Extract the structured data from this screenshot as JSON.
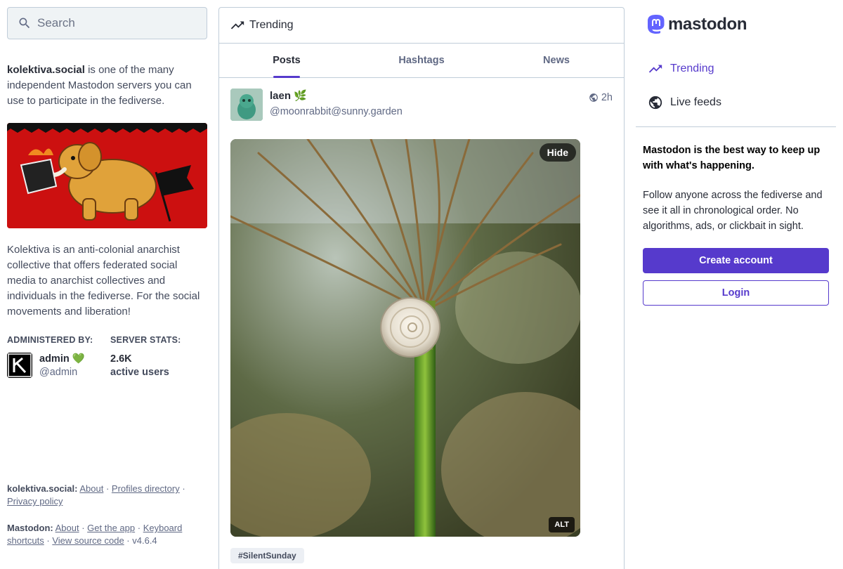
{
  "search": {
    "placeholder": "Search"
  },
  "about": {
    "server_name": "kolektiva.social",
    "intro_rest": " is one of the many independent Mastodon servers you can use to participate in the fediverse.",
    "description": "Kolektiva is an anti-colonial anarchist collective that offers federated social media to anarchist collectives and individuals in the fediverse. For the social movements and liberation!",
    "administered_by_label": "ADMINISTERED BY:",
    "server_stats_label": "SERVER STATS:",
    "admin_name": "admin",
    "admin_emoji": "💚",
    "admin_handle": "@admin",
    "active_users_value": "2.6K",
    "active_users_label": "active users"
  },
  "footer": {
    "server_label": "kolektiva.social:",
    "server_links": [
      "About",
      "Profiles directory",
      "Privacy policy"
    ],
    "mastodon_label": "Mastodon:",
    "mastodon_links": [
      "About",
      "Get the app",
      "Keyboard shortcuts",
      "View source code"
    ],
    "version": "v4.6.4",
    "separator": " · "
  },
  "column": {
    "title": "Trending",
    "tabs": [
      {
        "label": "Posts",
        "active": true
      },
      {
        "label": "Hashtags",
        "active": false
      },
      {
        "label": "News",
        "active": false
      }
    ]
  },
  "post": {
    "display_name": "laen 🌿",
    "account": "@moonrabbit@sunny.garden",
    "time": "2h",
    "visibility_icon": "globe-icon",
    "media_hide_label": "Hide",
    "media_alt_label": "ALT",
    "hashtag": "#SilentSunday"
  },
  "sidebar": {
    "logo_text": "mastodon",
    "nav": [
      {
        "label": "Trending",
        "icon": "trending-icon",
        "active": true
      },
      {
        "label": "Live feeds",
        "icon": "globe-icon",
        "active": false
      }
    ],
    "cta_heading": "Mastodon is the best way to keep up with what's happening.",
    "cta_body": "Follow anyone across the fediverse and see it all in chronological order. No algorithms, ads, or clickbait in sight.",
    "create_account_label": "Create account",
    "login_label": "Login"
  },
  "colors": {
    "accent": "#563acc",
    "banner_red": "#cc1010",
    "text": "#282c37",
    "muted": "#606984"
  }
}
